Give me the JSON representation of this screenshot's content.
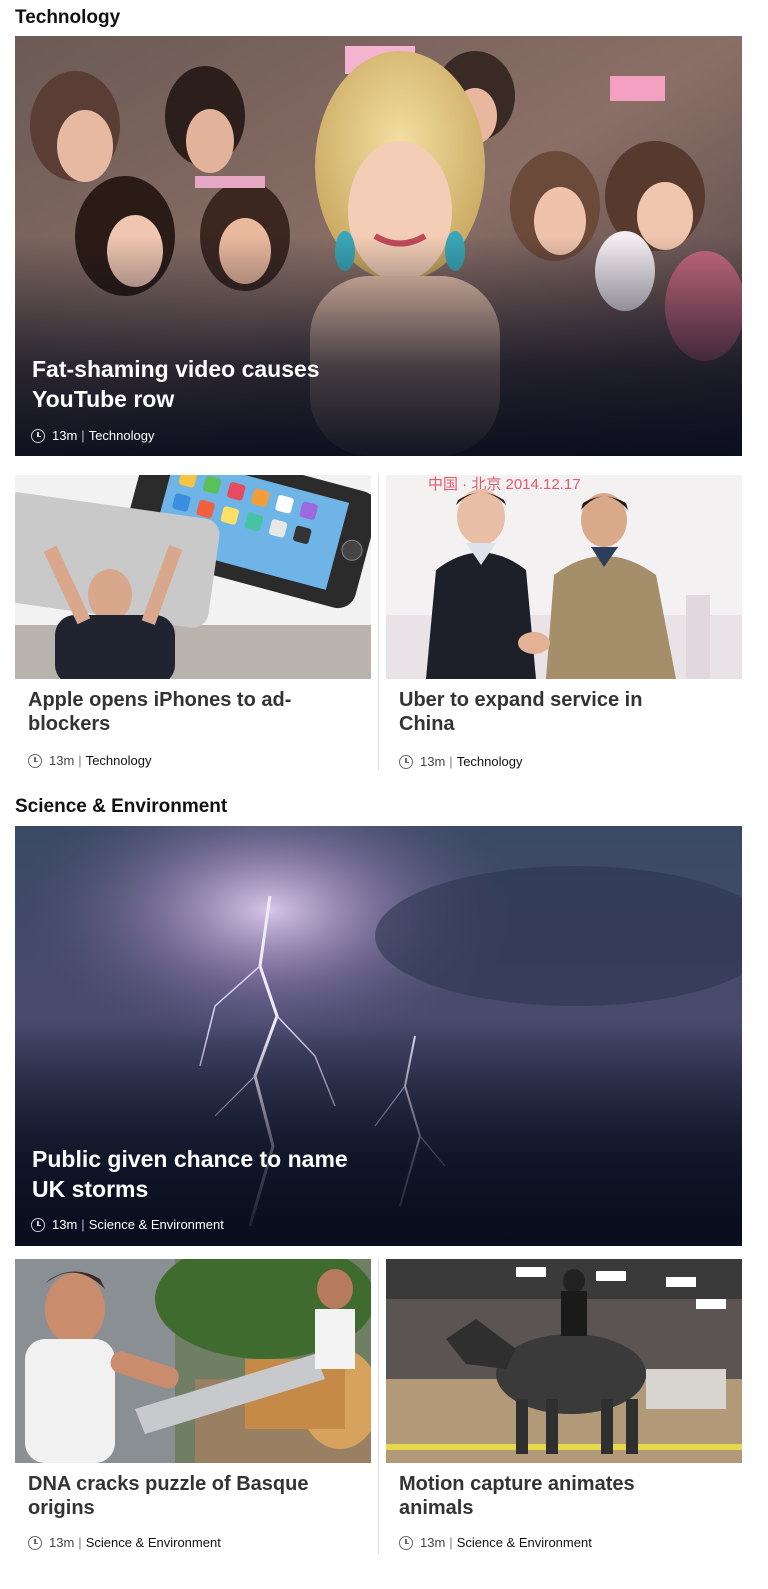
{
  "sections": [
    {
      "title": "Technology",
      "hero": {
        "headline": "Fat-shaming video causes YouTube row",
        "time": "13m",
        "category": "Technology"
      },
      "cards": [
        {
          "headline": "Apple opens iPhones to ad-blockers",
          "time": "13m",
          "category": "Technology"
        },
        {
          "headline": "Uber to expand service in China",
          "time": "13m",
          "category": "Technology"
        }
      ]
    },
    {
      "title": "Science & Environment",
      "hero": {
        "headline": "Public given chance to name UK storms",
        "time": "13m",
        "category": "Science & Environment"
      },
      "cards": [
        {
          "headline": "DNA cracks puzzle of Basque origins",
          "time": "13m",
          "category": "Science & Environment"
        },
        {
          "headline": "Motion capture animates animals",
          "time": "13m",
          "category": "Science & Environment"
        }
      ]
    }
  ],
  "image_text": {
    "uber_banner": "中国 · 北京  2014.12.17"
  },
  "separator": "|"
}
